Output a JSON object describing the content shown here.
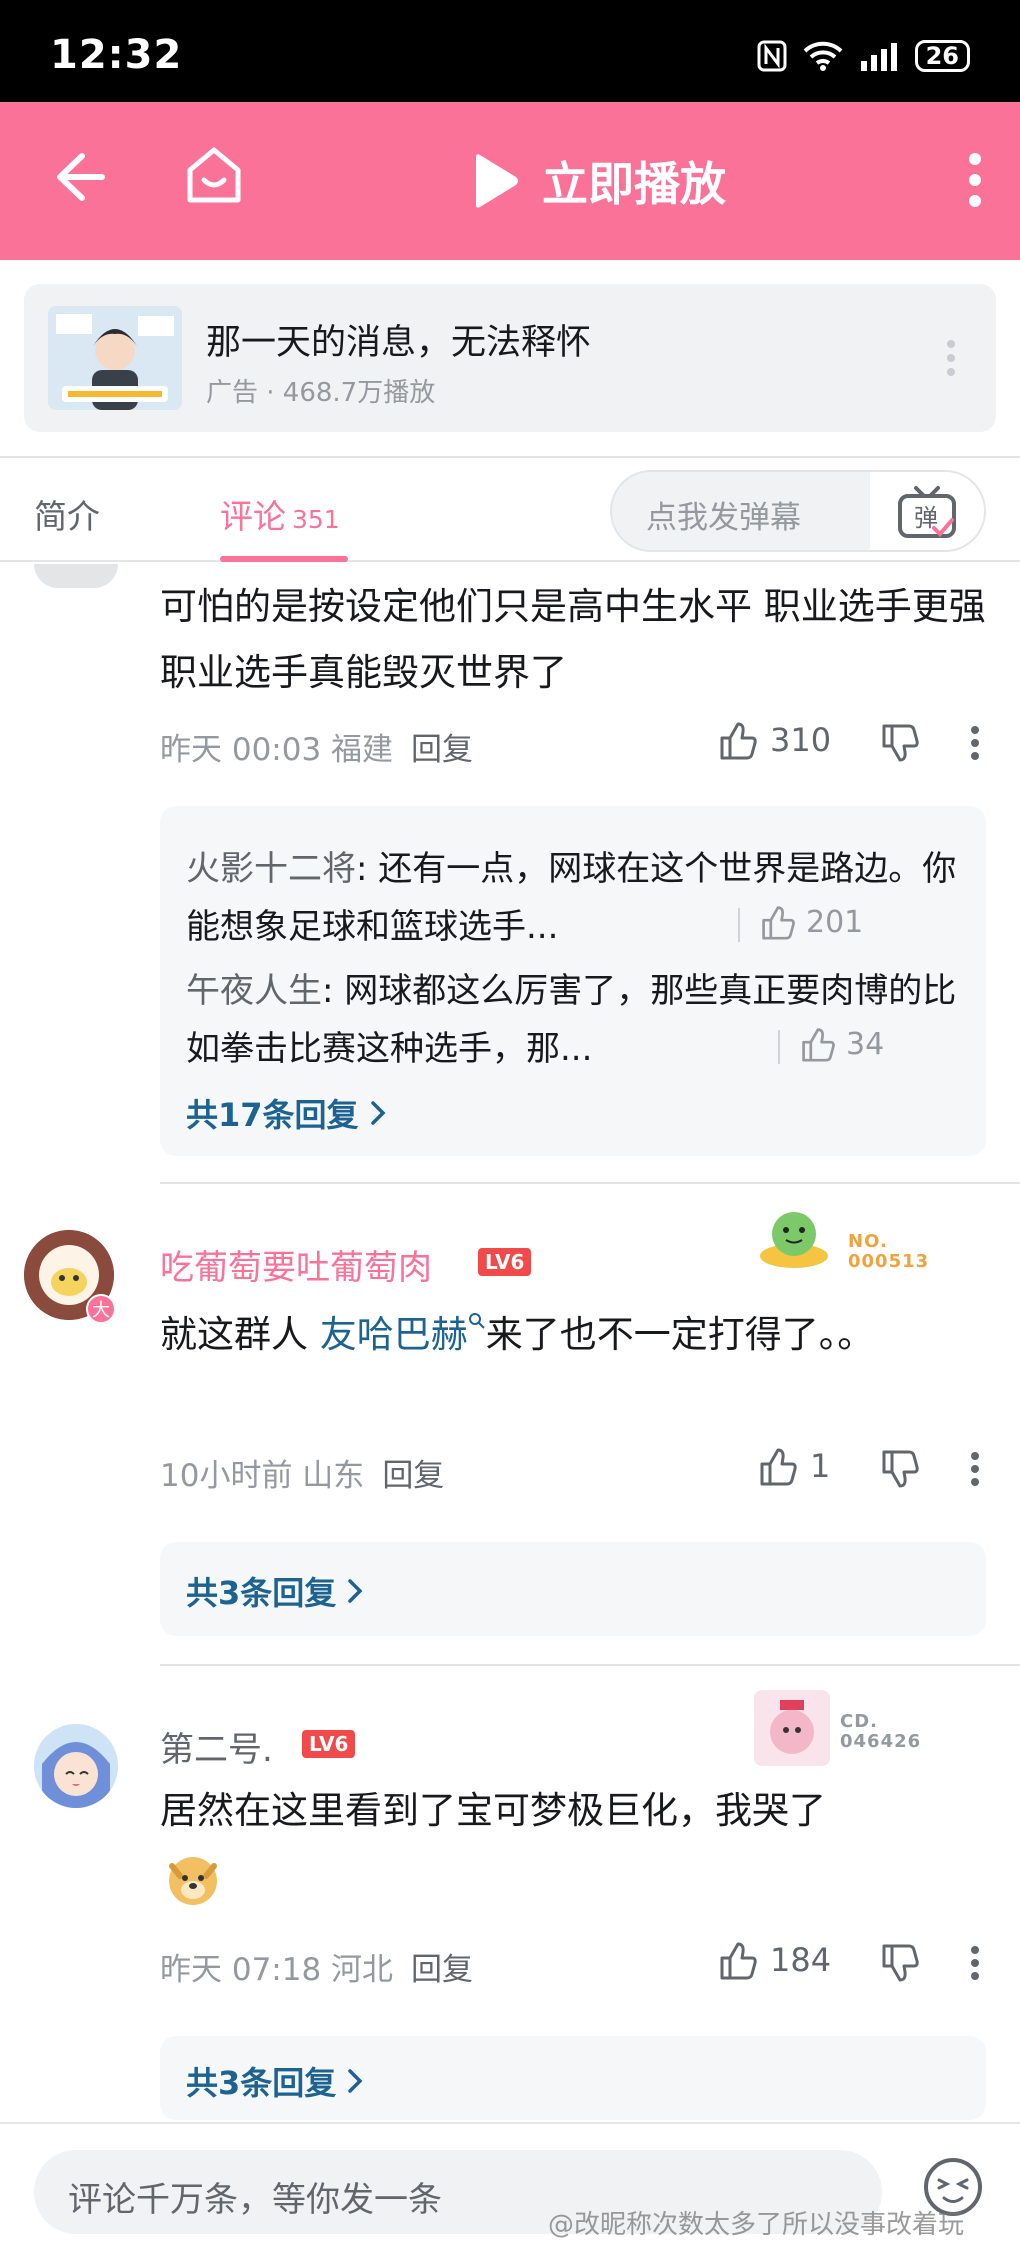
{
  "status_bar": {
    "time": "12:32",
    "battery": "26"
  },
  "header": {
    "play_label": "立即播放"
  },
  "ad": {
    "title": "那一天的消息，无法释怀",
    "subtitle": "广告 · 468.7万播放"
  },
  "tabs": {
    "intro": "简介",
    "comments": "评论",
    "comments_count": "351",
    "danmu_placeholder": "点我发弹幕",
    "danmu_btn": "弹"
  },
  "comments": [
    {
      "text": "可怕的是按设定他们只是高中生水平  职业选手更强  职业选手真能毁灭世界了",
      "time_loc": "昨天 00:03 福建",
      "reply": "回复",
      "likes": "310",
      "replies": [
        {
          "name": "火影十二将",
          "text": "还有一点，网球在这个世界是路边。你能想象足球和篮球选手...",
          "likes": "201"
        },
        {
          "name": "午夜人生",
          "text": "网球都这么厉害了，那些真正要肉博的比如拳击比赛这种选手，那...",
          "likes": "34"
        }
      ],
      "more_replies": "共17条回复"
    },
    {
      "user": "吃葡萄要吐葡萄肉",
      "level": "LV6",
      "badge": "NO. 000513",
      "text_before": "就这群人 ",
      "link": "友哈巴赫",
      "text_after": "来了也不一定打得了。。",
      "time_loc": "10小时前 山东",
      "reply": "回复",
      "likes": "1",
      "avatar_tag": "大",
      "more_replies": "共3条回复"
    },
    {
      "user": "第二号.",
      "level": "LV6",
      "badge": "CD. 046426",
      "text": "居然在这里看到了宝可梦极巨化，我哭了",
      "time_loc": "昨天 07:18 河北",
      "reply": "回复",
      "likes": "184",
      "more_replies": "共3条回复"
    }
  ],
  "bottom": {
    "placeholder": "评论千万条，等你发一条",
    "watermark": "@改昵称次数太多了所以没事改着玩"
  },
  "colors": {
    "brand_pink": "#fb7299",
    "link_blue": "#1c6391",
    "level_red": "#f04a4a"
  }
}
